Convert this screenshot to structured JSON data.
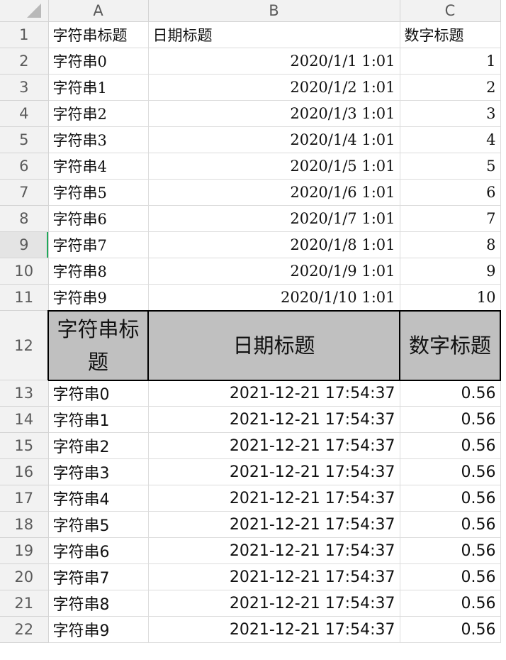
{
  "columns": [
    "A",
    "B",
    "C"
  ],
  "rows1": [
    {
      "num": "1",
      "a": "字符串标题",
      "b": "日期标题",
      "c": "数字标题"
    },
    {
      "num": "2",
      "a": "字符串0",
      "b": "2020/1/1 1:01",
      "c": "1"
    },
    {
      "num": "3",
      "a": "字符串1",
      "b": "2020/1/2 1:01",
      "c": "2"
    },
    {
      "num": "4",
      "a": "字符串2",
      "b": "2020/1/3 1:01",
      "c": "3"
    },
    {
      "num": "5",
      "a": "字符串3",
      "b": "2020/1/4 1:01",
      "c": "4"
    },
    {
      "num": "6",
      "a": "字符串4",
      "b": "2020/1/5 1:01",
      "c": "5"
    },
    {
      "num": "7",
      "a": "字符串5",
      "b": "2020/1/6 1:01",
      "c": "6"
    },
    {
      "num": "8",
      "a": "字符串6",
      "b": "2020/1/7 1:01",
      "c": "7"
    },
    {
      "num": "9",
      "a": "字符串7",
      "b": "2020/1/8 1:01",
      "c": "8"
    },
    {
      "num": "10",
      "a": "字符串8",
      "b": "2020/1/9 1:01",
      "c": "9"
    },
    {
      "num": "11",
      "a": "字符串9",
      "b": "2020/1/10 1:01",
      "c": "10"
    }
  ],
  "header_row": {
    "num": "12",
    "a": "字符串标题",
    "b": "日期标题",
    "c": "数字标题"
  },
  "rows2": [
    {
      "num": "13",
      "a": "字符串0",
      "b": "2021-12-21 17:54:37",
      "c": "0.56"
    },
    {
      "num": "14",
      "a": "字符串1",
      "b": "2021-12-21 17:54:37",
      "c": "0.56"
    },
    {
      "num": "15",
      "a": "字符串2",
      "b": "2021-12-21 17:54:37",
      "c": "0.56"
    },
    {
      "num": "16",
      "a": "字符串3",
      "b": "2021-12-21 17:54:37",
      "c": "0.56"
    },
    {
      "num": "17",
      "a": "字符串4",
      "b": "2021-12-21 17:54:37",
      "c": "0.56"
    },
    {
      "num": "18",
      "a": "字符串5",
      "b": "2021-12-21 17:54:37",
      "c": "0.56"
    },
    {
      "num": "19",
      "a": "字符串6",
      "b": "2021-12-21 17:54:37",
      "c": "0.56"
    },
    {
      "num": "20",
      "a": "字符串7",
      "b": "2021-12-21 17:54:37",
      "c": "0.56"
    },
    {
      "num": "21",
      "a": "字符串8",
      "b": "2021-12-21 17:54:37",
      "c": "0.56"
    },
    {
      "num": "22",
      "a": "字符串9",
      "b": "2021-12-21 17:54:37",
      "c": "0.56"
    }
  ],
  "selected_row": "9",
  "colors": {
    "header_fill": "#c0c0c0",
    "selection": "#1fa85a",
    "grid": "#dcdcdc"
  }
}
